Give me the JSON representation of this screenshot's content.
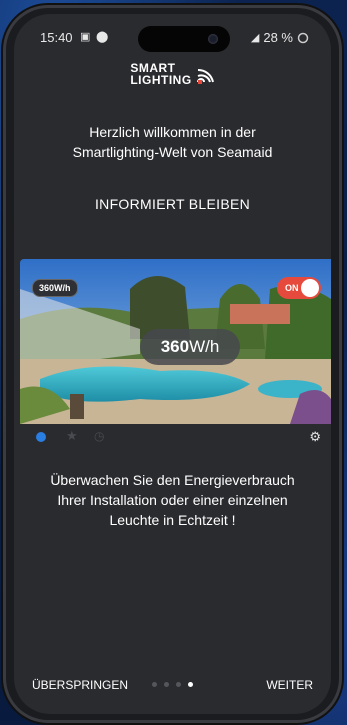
{
  "status": {
    "time": "15:40",
    "battery": "28 %",
    "icons": [
      "image-icon",
      "location-icon",
      "signal-icon",
      "battery-icon"
    ]
  },
  "logo": {
    "line1": "SMART",
    "line2": "LIGHTING"
  },
  "welcome": {
    "line1": "Herzlich willkommen in der",
    "line2": "Smartlighting-Welt von Seamaid"
  },
  "heading": "INFORMIERT BLEIBEN",
  "media": {
    "kwh_small": "360W/h",
    "toggle_label": "ON",
    "kwh_value": "360",
    "kwh_unit": "W/h"
  },
  "description": {
    "line1": "Überwachen Sie den Energieverbrauch",
    "line2": "Ihrer Installation oder einer einzelnen",
    "line3": "Leuchte in Echtzeit !"
  },
  "nav": {
    "skip_label": "ÜBERSPRINGEN",
    "next_label": "WEITER",
    "page_count": 4,
    "active_page": 4
  },
  "colors": {
    "accent_blue": "#2a7de1",
    "toggle_red": "#e64a3c",
    "screen_bg": "#2a2b2f"
  }
}
